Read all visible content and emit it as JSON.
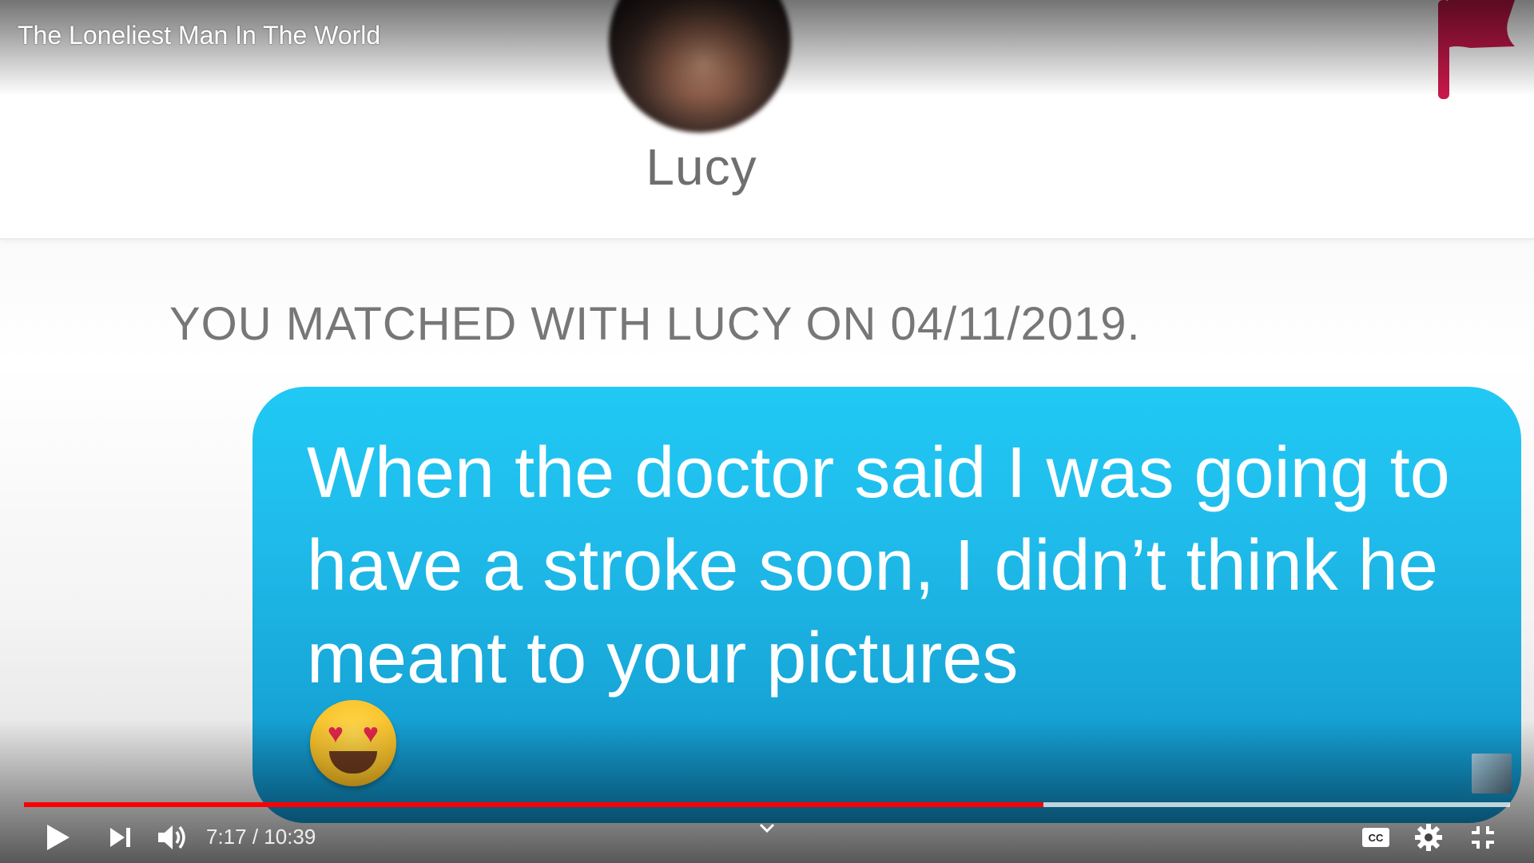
{
  "video": {
    "title": "The Loneliest Man In The World"
  },
  "app": {
    "contact_name": "Lucy",
    "match_notice": "YOU MATCHED WITH LUCY ON 04/11/2019.",
    "message_text": "When the doctor said I was going to have a stroke soon, I didn’t think he meant to your pictures",
    "message_emoji": "heart-eyes-emoji",
    "flag_color": "#c8184a",
    "bubble_color": "#1fbbea"
  },
  "player": {
    "current_time": "7:17",
    "separator": " / ",
    "duration": "10:39",
    "progress_played": 0.6858,
    "progress_loaded": 1.0,
    "progress_color": "#ff0000",
    "icons": [
      "play-icon",
      "next-icon",
      "volume-icon",
      "chevron-down-icon",
      "captions-icon",
      "settings-icon",
      "exit-fullscreen-icon"
    ]
  }
}
